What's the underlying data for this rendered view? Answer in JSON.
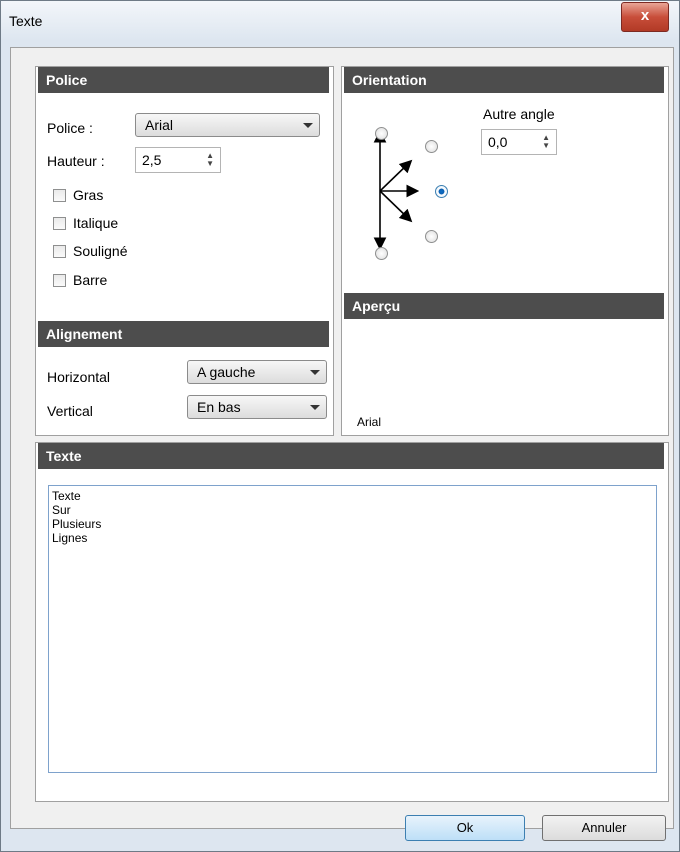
{
  "window": {
    "title": "Texte",
    "close_glyph": "x"
  },
  "police": {
    "header": "Police",
    "font_label": "Police :",
    "font_value": "Arial",
    "height_label": "Hauteur :",
    "height_value": "2,5",
    "styles": [
      {
        "label": "Gras",
        "checked": false
      },
      {
        "label": "Italique",
        "checked": false
      },
      {
        "label": "Souligné",
        "checked": false
      },
      {
        "label": "Barre",
        "checked": false
      }
    ]
  },
  "alignement": {
    "header": "Alignement",
    "horizontal_label": "Horizontal",
    "horizontal_value": "A gauche",
    "vertical_label": "Vertical",
    "vertical_value": "En bas"
  },
  "orientation": {
    "header": "Orientation",
    "other_angle_label": "Autre angle",
    "other_angle_value": "0,0",
    "selected_direction": "east"
  },
  "apercu": {
    "header": "Aperçu",
    "sample_text": "Arial"
  },
  "texte": {
    "header": "Texte",
    "content": "Texte\nSur\nPlusieurs\nLignes"
  },
  "buttons": {
    "ok": "Ok",
    "cancel": "Annuler"
  }
}
